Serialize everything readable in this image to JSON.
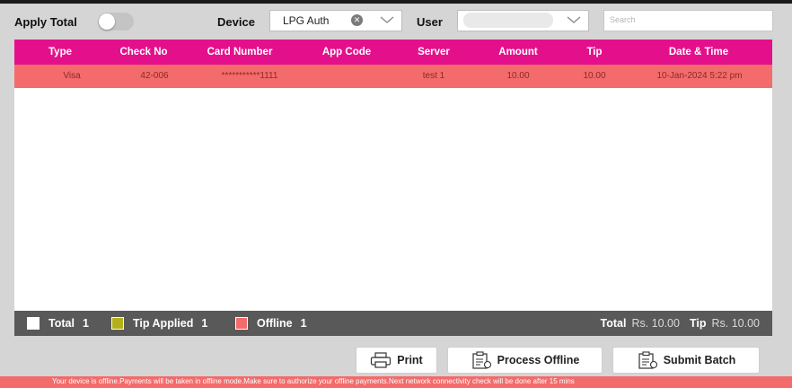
{
  "header": {
    "apply_total_label": "Apply Total",
    "apply_total_on": false,
    "device_label": "Device",
    "device_value": "LPG Auth",
    "user_label": "User",
    "user_value": "",
    "search_placeholder": "Search"
  },
  "table": {
    "columns": [
      "Type",
      "Check No",
      "Card Number",
      "App Code",
      "Server",
      "Amount",
      "Tip",
      "Date & Time"
    ],
    "rows": [
      [
        "Visa",
        "42-006",
        "***********1111",
        "",
        "test 1",
        "10.00",
        "10.00",
        "10-Jan-2024 5:22 pm"
      ]
    ]
  },
  "summary": {
    "total_label": "Total",
    "total_count": "1",
    "tip_applied_label": "Tip Applied",
    "tip_applied_count": "1",
    "offline_label": "Offline",
    "offline_count": "1",
    "sum_total_label": "Total",
    "sum_total_value": "Rs. 10.00",
    "sum_tip_label": "Tip",
    "sum_tip_value": "Rs. 10.00"
  },
  "buttons": {
    "print": "Print",
    "process_offline": "Process Offline",
    "submit_batch": "Submit Batch"
  },
  "status_message": "Your device is offline.Payments will be taken in offline mode.Make sure to authorize your offline payments.Next network connectivity check will be done after 15 mins",
  "colors": {
    "header_magenta": "#e4108b",
    "offline_row": "#f36b6b",
    "footer_gray": "#595959",
    "tip_swatch": "#b4b01a",
    "offline_swatch": "#f36b6b",
    "total_swatch": "#ffffff"
  },
  "icons": {
    "device_clear": "clear-circle-icon",
    "dropdown": "chevron-down-icon",
    "print": "printer-icon",
    "process_offline": "clipboard-icon",
    "submit_batch": "clipboard-icon"
  }
}
